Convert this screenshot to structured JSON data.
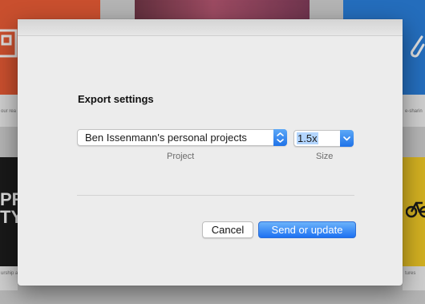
{
  "dialog": {
    "title": "Export settings",
    "project_select": {
      "value": "Ben Issenmann's personal projects",
      "label": "Project"
    },
    "size_select": {
      "value": "1.5x",
      "label": "Size"
    },
    "buttons": {
      "cancel": "Cancel",
      "send": "Send or update"
    }
  },
  "background": {
    "captions": [
      "our rea",
      "e-sharin",
      "urship a",
      "tures"
    ],
    "poster_text": "PR\nTY"
  },
  "colors": {
    "accent": "#1d71f2",
    "bg_orange": "#e8532b",
    "bg_blue": "#1f78d8",
    "bg_yellow": "#f2c81c"
  }
}
